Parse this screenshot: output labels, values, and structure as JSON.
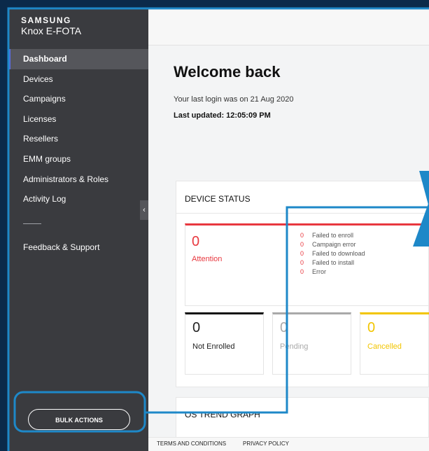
{
  "brand": {
    "line1": "SAMSUNG",
    "line2": "Knox E-FOTA"
  },
  "sidebar": {
    "items": [
      {
        "label": "Dashboard"
      },
      {
        "label": "Devices"
      },
      {
        "label": "Campaigns"
      },
      {
        "label": "Licenses"
      },
      {
        "label": "Resellers"
      },
      {
        "label": "EMM groups"
      },
      {
        "label": "Administrators & Roles"
      },
      {
        "label": "Activity Log"
      }
    ],
    "feedback_label": "Feedback & Support",
    "collapse_glyph": "‹",
    "bulk_actions_label": "BULK ACTIONS"
  },
  "main": {
    "welcome": "Welcome back",
    "last_login": "Your last login was on 21 Aug 2020",
    "last_updated": "Last updated: 12:05:09 PM"
  },
  "device_status": {
    "title": "DEVICE STATUS",
    "attention_count": "0",
    "attention_label": "Attention",
    "errors": [
      {
        "count": "0",
        "label": "Failed to enroll"
      },
      {
        "count": "0",
        "label": "Campaign error"
      },
      {
        "count": "0",
        "label": "Failed to download"
      },
      {
        "count": "0",
        "label": "Failed to install"
      },
      {
        "count": "0",
        "label": "Error"
      }
    ],
    "not_enrolled": {
      "count": "0",
      "label": "Not Enrolled"
    },
    "pending": {
      "count": "0",
      "label": "Pending"
    },
    "cancelled": {
      "count": "0",
      "label": "Cancelled"
    }
  },
  "os_trend": {
    "title": "OS TREND GRAPH"
  },
  "footer": {
    "terms": "TERMS AND CONDITIONS",
    "privacy": "PRIVACY POLICY"
  },
  "colors": {
    "background": "#0b2a4a",
    "sidebar": "#3a3b3f",
    "active_indicator": "#5b6ee8",
    "attention": "#e8383f",
    "cancelled": "#f2c500",
    "annotation": "#1e88c8"
  }
}
